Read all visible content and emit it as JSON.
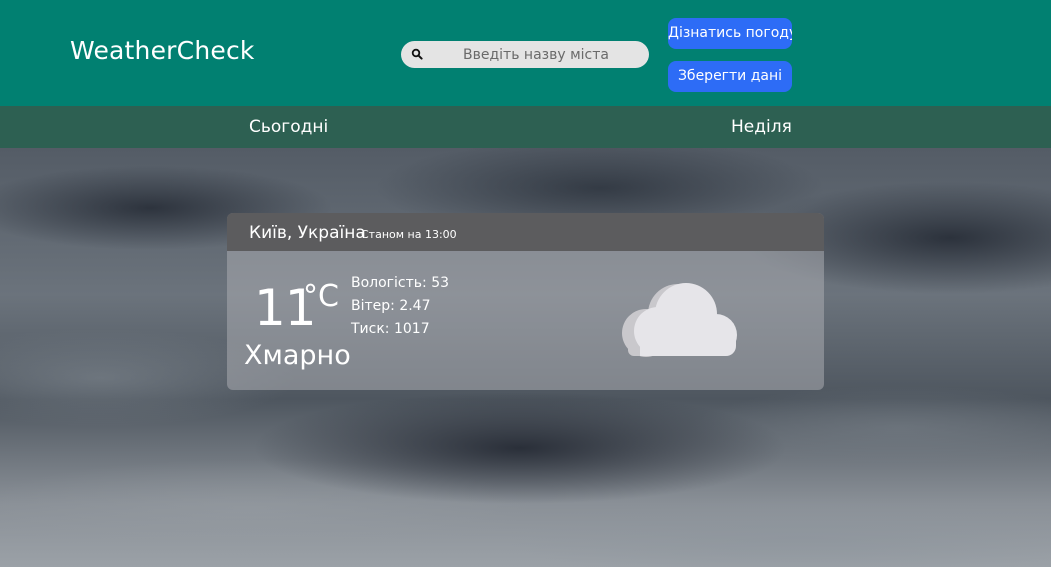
{
  "header": {
    "logo": "WeatherCheck",
    "search_placeholder": "Введіть назву міста",
    "get_weather_label": "Дізнатись погоду",
    "save_label": "Зберегти дані",
    "colors": {
      "bar": "#018071",
      "button": "#2d6cf6"
    }
  },
  "nav": {
    "tabs": [
      {
        "label": "Сьогодні"
      },
      {
        "label": "Неділя"
      }
    ],
    "color": "#2d6052"
  },
  "card": {
    "city": "Київ, Україна",
    "as_of": "Станом на 13:00",
    "temperature": "11",
    "unit": "°C",
    "description": "Хмарно",
    "humidity": "Вологість: 53",
    "wind": "Вітер: 2.47",
    "pressure": "Тиск: 1017",
    "icon": "cloud-icon"
  }
}
